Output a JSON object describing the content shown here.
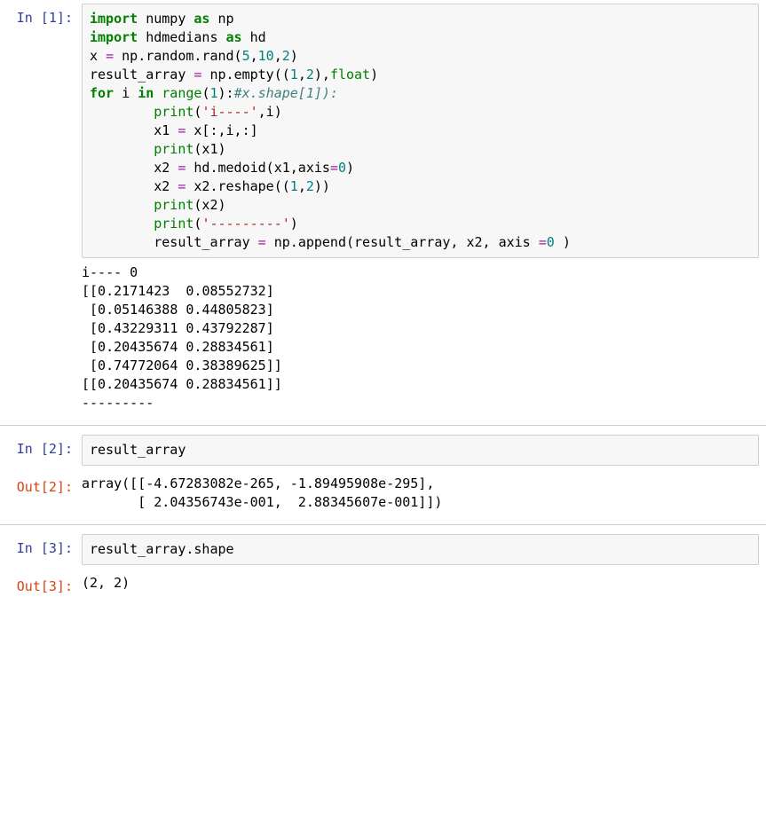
{
  "cells": [
    {
      "prompt_in": "In [1]:",
      "code_tokens": [
        {
          "t": "import",
          "c": "kw"
        },
        {
          "t": " numpy ",
          "c": ""
        },
        {
          "t": "as",
          "c": "kw"
        },
        {
          "t": " np\n",
          "c": ""
        },
        {
          "t": "import",
          "c": "kw"
        },
        {
          "t": " hdmedians ",
          "c": ""
        },
        {
          "t": "as",
          "c": "kw"
        },
        {
          "t": " hd\n",
          "c": ""
        },
        {
          "t": "x ",
          "c": ""
        },
        {
          "t": "=",
          "c": "op"
        },
        {
          "t": " np",
          "c": ""
        },
        {
          "t": ".",
          "c": ""
        },
        {
          "t": "random",
          "c": ""
        },
        {
          "t": ".",
          "c": ""
        },
        {
          "t": "rand(",
          "c": ""
        },
        {
          "t": "5",
          "c": "num"
        },
        {
          "t": ",",
          "c": ""
        },
        {
          "t": "10",
          "c": "num"
        },
        {
          "t": ",",
          "c": ""
        },
        {
          "t": "2",
          "c": "num"
        },
        {
          "t": ")\n",
          "c": ""
        },
        {
          "t": "result_array ",
          "c": ""
        },
        {
          "t": "=",
          "c": "op"
        },
        {
          "t": " np",
          "c": ""
        },
        {
          "t": ".",
          "c": ""
        },
        {
          "t": "empty((",
          "c": ""
        },
        {
          "t": "1",
          "c": "num"
        },
        {
          "t": ",",
          "c": ""
        },
        {
          "t": "2",
          "c": "num"
        },
        {
          "t": "),",
          "c": ""
        },
        {
          "t": "float",
          "c": "bi"
        },
        {
          "t": ")\n",
          "c": ""
        },
        {
          "t": "for",
          "c": "kw"
        },
        {
          "t": " i ",
          "c": ""
        },
        {
          "t": "in",
          "c": "kw"
        },
        {
          "t": " ",
          "c": ""
        },
        {
          "t": "range",
          "c": "bi"
        },
        {
          "t": "(",
          "c": ""
        },
        {
          "t": "1",
          "c": "num"
        },
        {
          "t": "):",
          "c": ""
        },
        {
          "t": "#x.shape[1]):",
          "c": "cmt"
        },
        {
          "t": "\n",
          "c": ""
        },
        {
          "t": "        ",
          "c": ""
        },
        {
          "t": "print",
          "c": "bi"
        },
        {
          "t": "(",
          "c": ""
        },
        {
          "t": "'i----'",
          "c": "str"
        },
        {
          "t": ",i)\n",
          "c": ""
        },
        {
          "t": "        x1 ",
          "c": ""
        },
        {
          "t": "=",
          "c": "op"
        },
        {
          "t": " x[:,i,:]\n",
          "c": ""
        },
        {
          "t": "        ",
          "c": ""
        },
        {
          "t": "print",
          "c": "bi"
        },
        {
          "t": "(x1)\n",
          "c": ""
        },
        {
          "t": "        x2 ",
          "c": ""
        },
        {
          "t": "=",
          "c": "op"
        },
        {
          "t": " hd",
          "c": ""
        },
        {
          "t": ".",
          "c": ""
        },
        {
          "t": "medoid(x1,axis",
          "c": ""
        },
        {
          "t": "=",
          "c": "op"
        },
        {
          "t": "0",
          "c": "num"
        },
        {
          "t": ")\n",
          "c": ""
        },
        {
          "t": "        x2 ",
          "c": ""
        },
        {
          "t": "=",
          "c": "op"
        },
        {
          "t": " x2",
          "c": ""
        },
        {
          "t": ".",
          "c": ""
        },
        {
          "t": "reshape((",
          "c": ""
        },
        {
          "t": "1",
          "c": "num"
        },
        {
          "t": ",",
          "c": ""
        },
        {
          "t": "2",
          "c": "num"
        },
        {
          "t": "))\n",
          "c": ""
        },
        {
          "t": "        ",
          "c": ""
        },
        {
          "t": "print",
          "c": "bi"
        },
        {
          "t": "(x2)\n",
          "c": ""
        },
        {
          "t": "        ",
          "c": ""
        },
        {
          "t": "print",
          "c": "bi"
        },
        {
          "t": "(",
          "c": ""
        },
        {
          "t": "'---------'",
          "c": "str"
        },
        {
          "t": ")\n",
          "c": ""
        },
        {
          "t": "        result_array ",
          "c": ""
        },
        {
          "t": "=",
          "c": "op"
        },
        {
          "t": " np",
          "c": ""
        },
        {
          "t": ".",
          "c": ""
        },
        {
          "t": "append(result_array, x2, axis ",
          "c": ""
        },
        {
          "t": "=",
          "c": "op"
        },
        {
          "t": "0",
          "c": "num"
        },
        {
          "t": " )",
          "c": ""
        }
      ],
      "stdout": "i---- 0\n[[0.2171423  0.08552732]\n [0.05146388 0.44805823]\n [0.43229311 0.43792287]\n [0.20435674 0.28834561]\n [0.74772064 0.38389625]]\n[[0.20435674 0.28834561]]\n---------"
    },
    {
      "prompt_in": "In [2]:",
      "code_plain": "result_array",
      "prompt_out": "Out[2]:",
      "result": "array([[-4.67283082e-265, -1.89495908e-295],\n       [ 2.04356743e-001,  2.88345607e-001]])"
    },
    {
      "prompt_in": "In [3]:",
      "code_plain": "result_array.shape",
      "prompt_out": "Out[3]:",
      "result": "(2, 2)"
    }
  ]
}
